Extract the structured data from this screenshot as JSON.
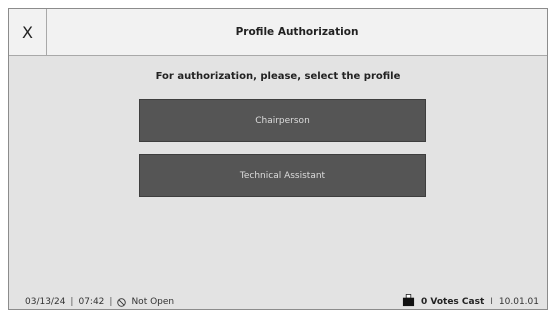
{
  "header": {
    "close_label": "X",
    "title": "Profile Authorization"
  },
  "main": {
    "instruction": "For authorization, please, select the profile",
    "profiles": [
      {
        "label": "Chairperson"
      },
      {
        "label": "Technical Assistant"
      }
    ]
  },
  "footer": {
    "date": "03/13/24",
    "time": "07:42",
    "status": "Not Open",
    "status_icon": "no-entry-icon",
    "votes_icon": "ballot-box-icon",
    "votes": "0 Votes Cast",
    "version": "10.01.01"
  },
  "colors": {
    "background": "#e3e3e3",
    "header": "#f2f2f2",
    "button": "#555555",
    "button_text": "#dcdcdc"
  }
}
